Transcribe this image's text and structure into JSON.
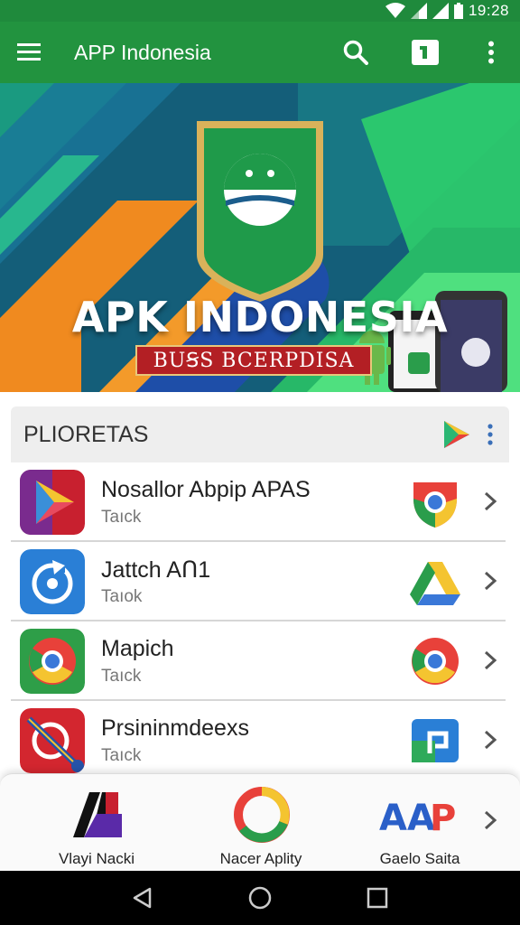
{
  "status_bar": {
    "time": "19:28",
    "icons": [
      "wifi-icon",
      "signal-icon",
      "signal-icon",
      "battery-icon"
    ]
  },
  "toolbar": {
    "title": "APP Indonesia",
    "menu_icon": "hamburger-menu-icon",
    "search_icon": "search-icon",
    "badge_icon": "id-badge-icon",
    "more_icon": "more-vert-icon"
  },
  "banner": {
    "title": "APK INDONESIA",
    "ribbon": "BUꞨS BCERPDISA"
  },
  "section": {
    "title": "PLIORETAS",
    "action_icon": "play-store-icon",
    "more_icon": "more-vert-icon"
  },
  "apps": [
    {
      "name": "Nosallor Abpip APAS",
      "subtitle": "Taıck",
      "icon": "play-store-icon",
      "badge": "chrome-icon"
    },
    {
      "name": "Jattch AՈ1",
      "subtitle": "Taıok",
      "icon": "sync-icon",
      "badge": "drive-icon"
    },
    {
      "name": "Mapich",
      "subtitle": "Taıck",
      "icon": "chrome-icon",
      "badge": "chrome-icon"
    },
    {
      "name": "Prsininmdeexs",
      "subtitle": "Taıck",
      "icon": "target-icon",
      "badge": "square-link-icon"
    }
  ],
  "featured": [
    {
      "label": "Vlayi Nacki",
      "icon": "mx-logo-icon"
    },
    {
      "label": "Nacer Aplity",
      "icon": "chrome-ring-icon"
    },
    {
      "label": "Gaelo Saita",
      "icon": "aap-text-logo",
      "logo_text": "AAP"
    }
  ],
  "nav": {
    "back": "back-icon",
    "home": "home-icon",
    "recents": "recents-icon"
  },
  "colors": {
    "primary": "#22933f",
    "status": "#1f8a3c",
    "banner_bg": "#13607a",
    "ribbon": "#b31f24"
  }
}
